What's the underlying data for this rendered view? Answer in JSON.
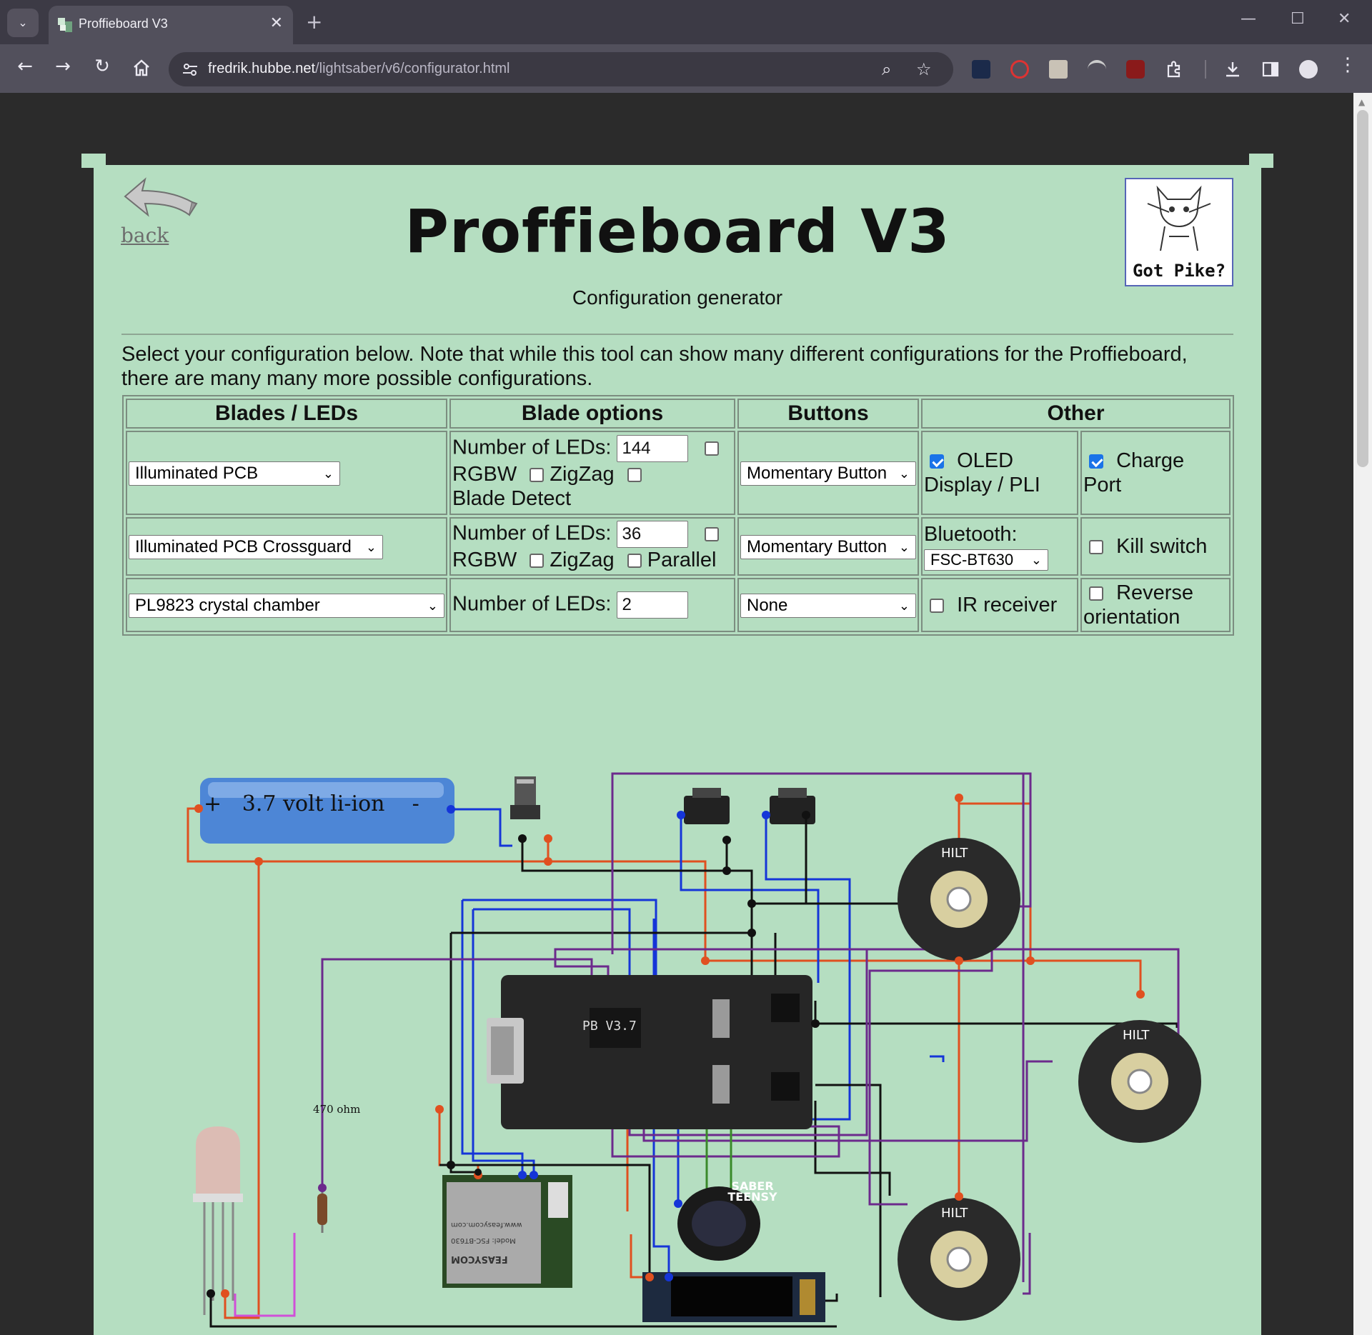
{
  "browser": {
    "tab_title": "Proffieboard V3",
    "url_host": "fredrik.hubbe.net",
    "url_path": "/lightsaber/v6/configurator.html"
  },
  "page": {
    "back_label": "back",
    "title": "Proffieboard V3",
    "subtitle": "Configuration generator",
    "badge_text": "Got Pike?",
    "intro": "Select your configuration below. Note that while this tool can show many different configurations for the Proffieboard, there are many many more possible configurations."
  },
  "table": {
    "headers": [
      "Blades / LEDs",
      "Blade options",
      "Buttons",
      "Other"
    ],
    "rows": [
      {
        "blade": "Illuminated PCB",
        "leds_label": "Number of LEDs:",
        "leds": "144",
        "rgbw": "RGBW",
        "zigzag": "ZigZag",
        "extra": "Blade Detect",
        "button": "Momentary Button",
        "other1_label": "OLED Display / PLI",
        "other2_label": "Charge Port"
      },
      {
        "blade": "Illuminated PCB Crossguard",
        "leds_label": "Number of LEDs:",
        "leds": "36",
        "rgbw": "RGBW",
        "zigzag": "ZigZag",
        "extra": "Parallel",
        "button": "Momentary Button",
        "other1_label": "Bluetooth:",
        "other1_select": "FSC-BT630",
        "other2_label": "Kill switch"
      },
      {
        "blade": "PL9823 crystal chamber",
        "leds_label": "Number of LEDs:",
        "leds": "2",
        "button": "None",
        "other1_label": "IR receiver",
        "other2_label": "Reverse orientation"
      }
    ]
  },
  "diagram": {
    "battery_plus": "+",
    "battery_label": "3.7 volt li-ion",
    "battery_minus": "-",
    "resistor_label": "470 ohm",
    "board_label": "PB V3.7",
    "pcb_label": "HILT",
    "oled_label": "SABER TEENSY",
    "bt_brand": "FEASYCOM",
    "bt_model": "Model: FSC-BT630",
    "bt_web": "www.feasycom.com"
  }
}
